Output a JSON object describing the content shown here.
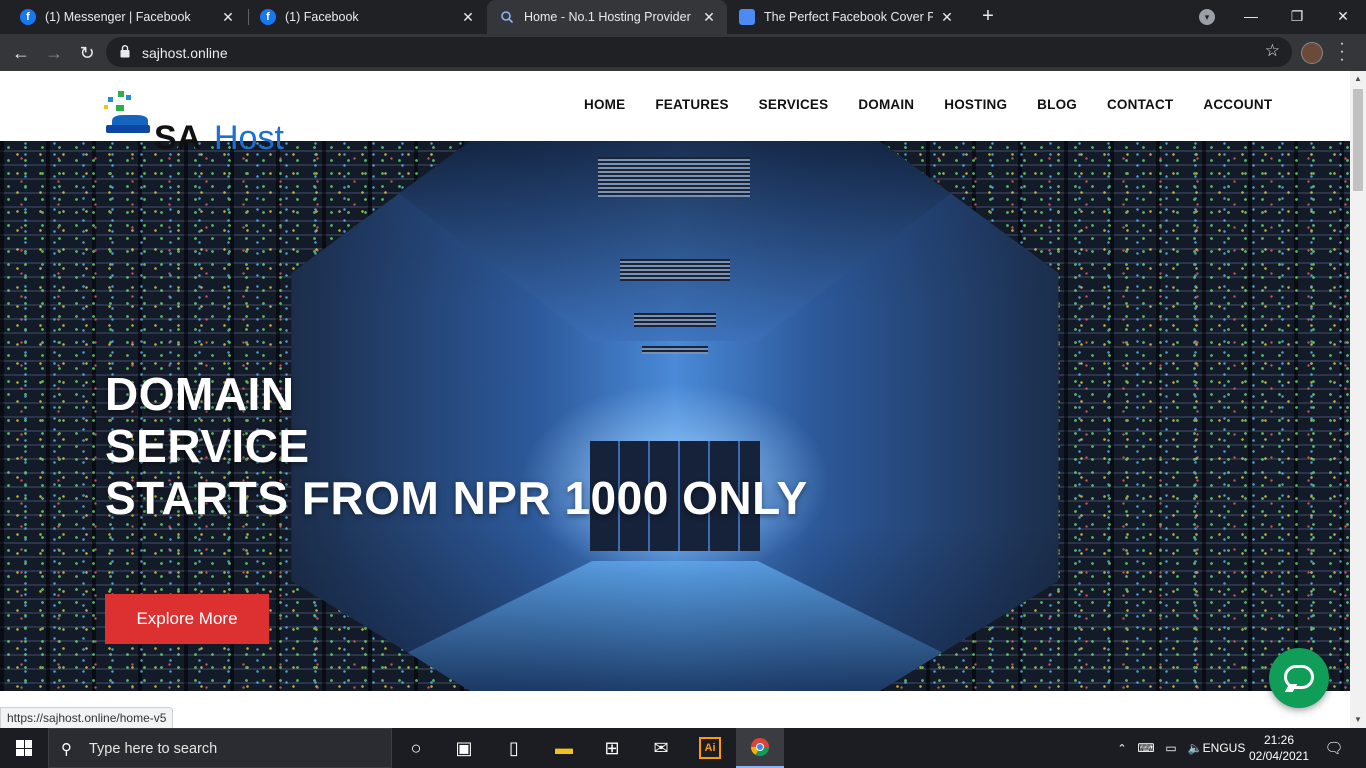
{
  "browser": {
    "tabs": [
      {
        "title": "(1) Messenger | Facebook",
        "icon": "facebook-icon",
        "active": false
      },
      {
        "title": "(1) Facebook",
        "icon": "facebook-icon",
        "active": false
      },
      {
        "title": "Home - No.1 Hosting Provider",
        "icon": "loading-icon",
        "active": true
      },
      {
        "title": "The Perfect Facebook Cover Phot",
        "icon": "doc-icon",
        "active": false
      }
    ],
    "url": "sajhost.online",
    "status_url": "https://sajhost.online/home-v5"
  },
  "site": {
    "nav": [
      "HOME",
      "FEATURES",
      "SERVICES",
      "DOMAIN",
      "HOSTING",
      "BLOG",
      "CONTACT",
      "ACCOUNT"
    ],
    "logo_text": "SAJ Host",
    "hero": {
      "line1": "DOMAIN",
      "line2": "SERVICE",
      "line3": "STARTS FROM NPR 1000 ONLY",
      "button": "Explore More"
    },
    "colors": {
      "accent": "#dd3131",
      "chat": "#0f9d58"
    }
  },
  "taskbar": {
    "search_placeholder": "Type here to search",
    "lang_line1": "ENG",
    "lang_line2": "US",
    "time": "21:26",
    "date": "02/04/2021"
  }
}
